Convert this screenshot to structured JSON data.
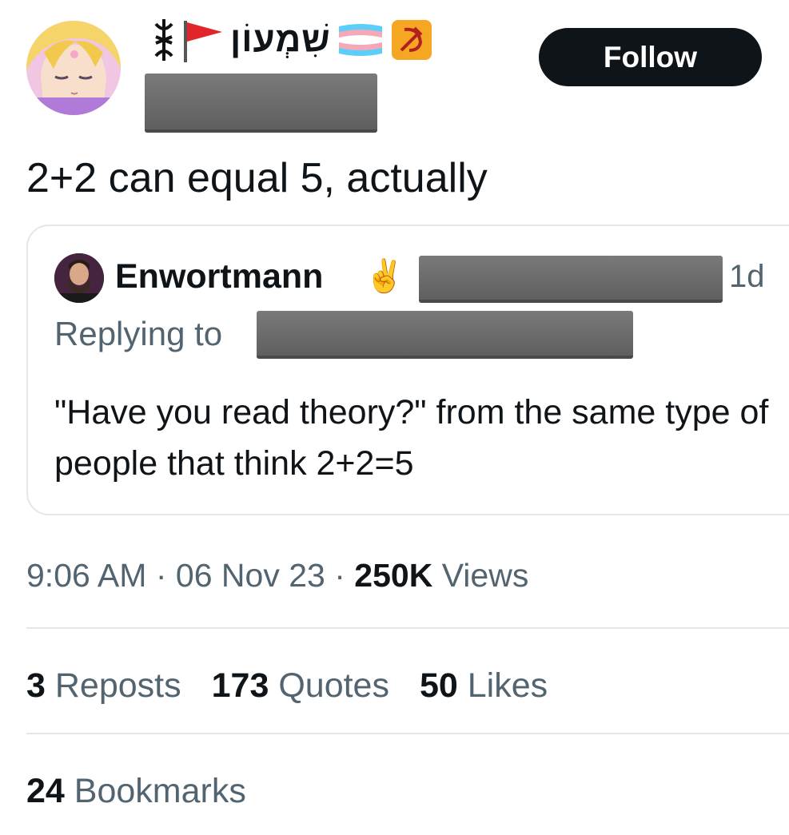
{
  "author": {
    "display_name": "שִׁמְעוֹן",
    "avatar_icon": "anime-character-avatar",
    "name_emoji_left": [
      "berserk-sigil-icon",
      "red-flag-icon"
    ],
    "name_emoji_right": [
      "trans-flag-icon",
      "hammer-sickle-icon"
    ]
  },
  "follow_label": "Follow",
  "tweet_text": "2+2 can equal 5, actually",
  "quote": {
    "author_name": "Enwortmann",
    "author_emoji": "✌️",
    "time_ago": "1d",
    "replying_to_label": "Replying to",
    "body": "\"Have you read theory?\" from the same type of people that think 2+2=5"
  },
  "meta": {
    "time": "9:06 AM",
    "date": "06 Nov 23",
    "views_count": "250K",
    "views_label": "Views",
    "separator": "·"
  },
  "stats": {
    "reposts_count": "3",
    "reposts_label": "Reposts",
    "quotes_count": "173",
    "quotes_label": "Quotes",
    "likes_count": "50",
    "likes_label": "Likes",
    "bookmarks_count": "24",
    "bookmarks_label": "Bookmarks"
  },
  "colors": {
    "text": "#0f1419",
    "secondary": "#536471",
    "border": "#e1e8ed",
    "button_bg": "#0f1419"
  }
}
